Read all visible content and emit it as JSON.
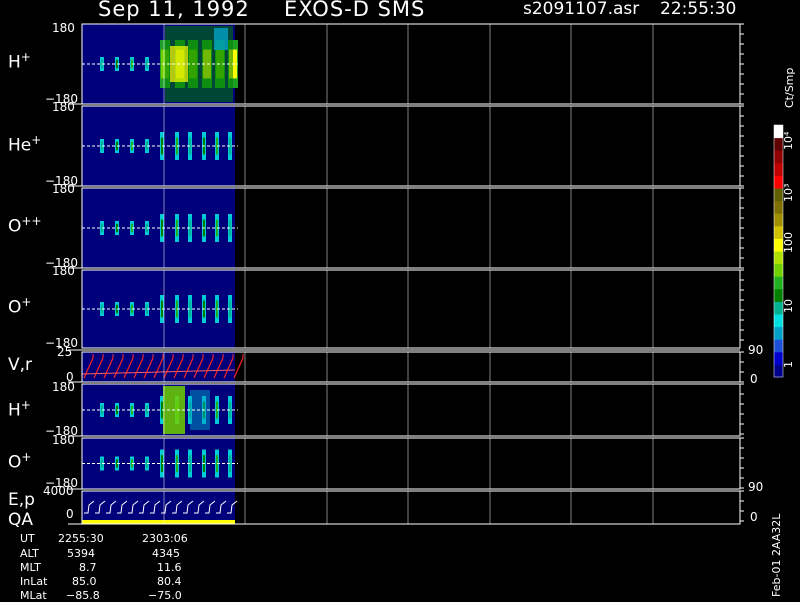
{
  "header": {
    "date": "Sep 11, 1992",
    "mission": "EXOS-D SMS",
    "file": "s2091107.asr",
    "time": "22:55:30"
  },
  "colorbar": {
    "unit": "Ct/Smp",
    "labels": [
      "1",
      "10",
      "100",
      "10³",
      "10⁴"
    ],
    "colors": [
      "#00008b",
      "#0000cd",
      "#1e4fd8",
      "#00a0c8",
      "#00e0e0",
      "#00b090",
      "#008000",
      "#20b020",
      "#70d000",
      "#b0e000",
      "#ffff00",
      "#d0c000",
      "#a09000",
      "#807000",
      "#606000",
      "#ff0000",
      "#c00000",
      "#900000",
      "#600000",
      "#ffffff"
    ]
  },
  "panels": [
    {
      "id": "h-plus",
      "ion": "H",
      "charge": "+",
      "ymax": "180",
      "ymin": "−180"
    },
    {
      "id": "he-plus",
      "ion": "He",
      "charge": "+",
      "ymax": "180",
      "ymin": "−180"
    },
    {
      "id": "o-plus-plus",
      "ion": "O",
      "charge": "++",
      "ymax": "180",
      "ymin": "−180"
    },
    {
      "id": "o-plus",
      "ion": "O",
      "charge": "+",
      "ymax": "180",
      "ymin": "−180"
    },
    {
      "id": "vr",
      "label": "V,r",
      "ymax": "25",
      "ymin": "0",
      "right_max": "90",
      "right_min": "0"
    },
    {
      "id": "h-plus-2",
      "ion": "H",
      "charge": "+",
      "ymax": "180",
      "ymin": "−180"
    },
    {
      "id": "o-plus-2",
      "ion": "O",
      "charge": "+",
      "ymax": "180",
      "ymin": "−180"
    },
    {
      "id": "ep-qa",
      "label": "E,p",
      "label2": "QA",
      "ymax": "4000",
      "ymin": "0",
      "right_max": "90",
      "right_min": "0"
    }
  ],
  "annotation": {
    "rows": [
      {
        "label": "UT",
        "v1": "2255:30",
        "v2": "2303:06"
      },
      {
        "label": "ALT",
        "v1": "5394",
        "v2": "4345"
      },
      {
        "label": "MLT",
        "v1": "8.7",
        "v2": "11.6"
      },
      {
        "label": "InLat",
        "v1": "85.0",
        "v2": "80.4"
      },
      {
        "label": "MLat",
        "v1": "−85.8",
        "v2": "−75.0"
      }
    ]
  },
  "footer": "Feb-01 2AA32L",
  "chart_data": {
    "type": "heatmap",
    "title": "Sep 11, 1992   EXOS-D SMS",
    "x_ticks": [
      "2255:30",
      "2303:06"
    ],
    "y_range": [
      -180,
      180
    ],
    "series": [
      {
        "name": "H+",
        "intensity": "bursts of 10–100 Ct/Smp; 100–1000 Ct/Smp near 2257"
      },
      {
        "name": "He+",
        "intensity": "bursts of 10–100 Ct/Smp"
      },
      {
        "name": "O++",
        "intensity": "bursts of 10–100 Ct/Smp"
      },
      {
        "name": "O+",
        "intensity": "bursts of 10–100 Ct/Smp"
      }
    ],
    "colorbar_range": [
      1,
      10000
    ],
    "colorbar_scale": "log"
  }
}
